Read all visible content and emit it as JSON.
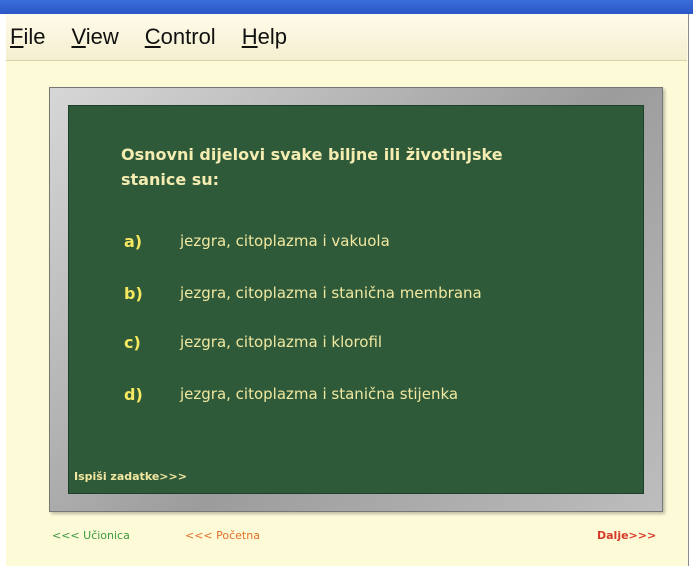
{
  "menu": {
    "items": [
      {
        "accel": "F",
        "rest": "ile"
      },
      {
        "accel": "V",
        "rest": "iew"
      },
      {
        "accel": "C",
        "rest": "ontrol"
      },
      {
        "accel": "H",
        "rest": "elp"
      }
    ]
  },
  "board": {
    "question_line1": "Osnovni dijelovi svake biljne ili životinjske",
    "question_line2": "stanice su:",
    "answers": [
      {
        "letter": "a)",
        "text": "jezgra, citoplazma i vakuola"
      },
      {
        "letter": "b)",
        "text": "jezgra, citoplazma i stanična membrana"
      },
      {
        "letter": "c)",
        "text": "jezgra, citoplazma i klorofil"
      },
      {
        "letter": "d)",
        "text": "jezgra, citoplazma i stanična stijenka"
      }
    ],
    "print_link": "Ispiši zadatke>>>"
  },
  "footer": {
    "classroom": "<<< Učionica",
    "home": "<<< Početna",
    "next": "Dalje>>>"
  },
  "colors": {
    "board": "#2f5a3a",
    "question_text": "#f4ecb0",
    "answer_letter": "#f6e860",
    "footer_green": "#3a9a3a",
    "footer_orange": "#e0702a",
    "footer_red": "#d63a2a"
  }
}
